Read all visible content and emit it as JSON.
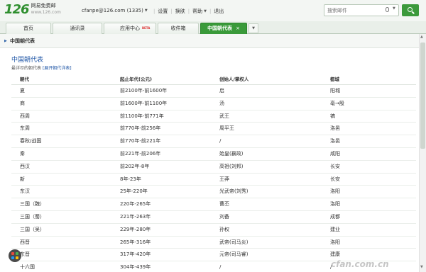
{
  "logo": {
    "number": "126",
    "name": "网易免费邮",
    "url": "www.126.com"
  },
  "account": {
    "email": "cfanpe@126.com",
    "unread": "(1335)"
  },
  "toplinks": [
    "设置",
    "换肤",
    "帮助",
    "退出"
  ],
  "search": {
    "placeholder": "搜索邮件"
  },
  "tabs": {
    "home": "首页",
    "contacts": "通讯录",
    "apps": "应用中心",
    "apps_badge": "BETA",
    "inbox": "收件箱",
    "active": "中国朝代表",
    "close": "×"
  },
  "breadcrumb": "中国朝代表",
  "page": {
    "title": "中国朝代表",
    "subtitle": "最详尽的朝代表",
    "expand_link": "[展开朝代详表]"
  },
  "table": {
    "headers": [
      "朝代",
      "起止年代(公元)",
      "创始人/掌权人",
      "都城"
    ],
    "rows": [
      [
        "夏",
        "前2100年-前1600年",
        "启",
        "阳城"
      ],
      [
        "商",
        "前1600年-前1100年",
        "汤",
        "亳→殷"
      ],
      [
        "西周",
        "前1100年-前771年",
        "武王",
        "镐"
      ],
      [
        "东周",
        "前770年-前256年",
        "周平王",
        "洛邑"
      ],
      [
        "春秋/战国",
        "前770年-前221年",
        "/",
        "洛邑"
      ],
      [
        "秦",
        "前221年-前206年",
        "始皇(嬴政)",
        "咸阳"
      ],
      [
        "西汉",
        "前202年-8年",
        "高祖(刘邦)",
        "长安"
      ],
      [
        "新",
        "8年-23年",
        "王莽",
        "长安"
      ],
      [
        "东汉",
        "25年-220年",
        "光武帝(刘秀)",
        "洛阳"
      ],
      [
        "三国（魏）",
        "220年-265年",
        "曹丕",
        "洛阳"
      ],
      [
        "三国（蜀）",
        "221年-263年",
        "刘备",
        "成都"
      ],
      [
        "三国（吴）",
        "229年-280年",
        "孙权",
        "建业"
      ],
      [
        "西晋",
        "265年-316年",
        "武帝(司马炎)",
        "洛阳"
      ],
      [
        "东晋",
        "317年-420年",
        "元帝(司马睿)",
        "建康"
      ],
      [
        "十六国",
        "304年-439年",
        "/",
        "/"
      ]
    ]
  },
  "watermark": "cfan.com.cn",
  "colors": {
    "brand_green": "#3a9a3a",
    "link_blue": "#1f56a6"
  }
}
